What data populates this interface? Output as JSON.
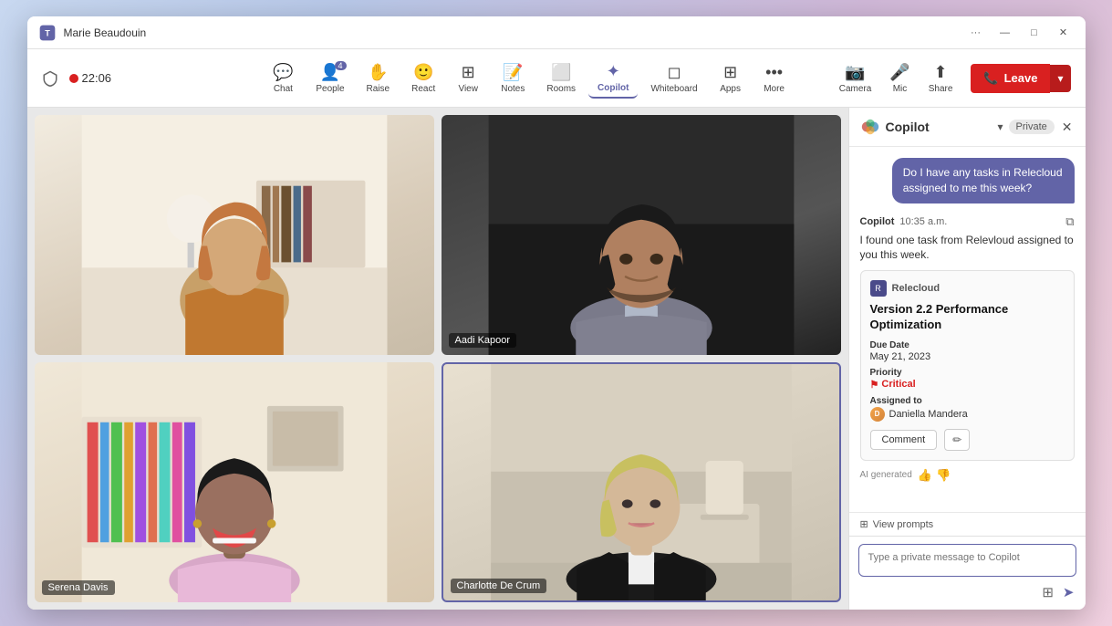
{
  "window": {
    "title": "Marie Beaudouin",
    "controls": {
      "more": "···",
      "minimize": "—",
      "maximize": "□",
      "close": "✕"
    }
  },
  "toolbar": {
    "timer": "22:06",
    "items": [
      {
        "id": "chat",
        "label": "Chat",
        "icon": "💬"
      },
      {
        "id": "people",
        "label": "People",
        "icon": "👤",
        "badge": "4"
      },
      {
        "id": "raise",
        "label": "Raise",
        "icon": "✋"
      },
      {
        "id": "react",
        "label": "React",
        "icon": "🙂"
      },
      {
        "id": "view",
        "label": "View",
        "icon": "⊞"
      },
      {
        "id": "notes",
        "label": "Notes",
        "icon": "📝"
      },
      {
        "id": "rooms",
        "label": "Rooms",
        "icon": "⬜"
      },
      {
        "id": "copilot",
        "label": "Copilot",
        "icon": "✦",
        "active": true
      },
      {
        "id": "whiteboard",
        "label": "Whiteboard",
        "icon": "◻"
      },
      {
        "id": "apps",
        "label": "Apps",
        "icon": "⊞"
      },
      {
        "id": "more",
        "label": "More",
        "icon": "···"
      }
    ],
    "right_items": [
      {
        "id": "camera",
        "label": "Camera",
        "icon": "📷"
      },
      {
        "id": "mic",
        "label": "Mic",
        "icon": "🎤"
      },
      {
        "id": "share",
        "label": "Share",
        "icon": "⬆"
      }
    ],
    "leave_label": "Leave"
  },
  "participants": [
    {
      "id": "p1",
      "name": "",
      "bg": "warm-home"
    },
    {
      "id": "p2",
      "name": "Aadi Kapoor",
      "bg": "dark-office"
    },
    {
      "id": "p3",
      "name": "Serena Davis",
      "bg": "home-shelves"
    },
    {
      "id": "p4",
      "name": "Charlotte De Crum",
      "bg": "office-clean",
      "active": true
    }
  ],
  "copilot": {
    "title": "Copilot",
    "dropdown_icon": "▾",
    "private_label": "Private",
    "close_icon": "✕",
    "user_message": "Do I have any tasks in Relecloud assigned to me this week?",
    "bot_name": "Copilot",
    "bot_timestamp": "10:35 a.m.",
    "bot_response": "I found one task from Relevloud assigned to you this week.",
    "copy_icon": "⧉",
    "task": {
      "app_name": "Relecloud",
      "app_icon": "R",
      "title": "Version 2.2 Performance Optimization",
      "due_date_label": "Due Date",
      "due_date": "May 21, 2023",
      "priority_label": "Priority",
      "priority": "Critical",
      "priority_icon": "⚑",
      "assigned_label": "Assigned to",
      "assigned_name": "Daniella Mandera",
      "comment_btn": "Comment",
      "edit_icon": "✏"
    },
    "ai_generated": "AI generated",
    "thumbs_up": "👍",
    "thumbs_down": "👎",
    "view_prompts_icon": "⊞",
    "view_prompts": "View prompts",
    "input_placeholder": "Type a private message to Copilot",
    "input_icon_1": "⊞",
    "send_icon": "➤"
  }
}
